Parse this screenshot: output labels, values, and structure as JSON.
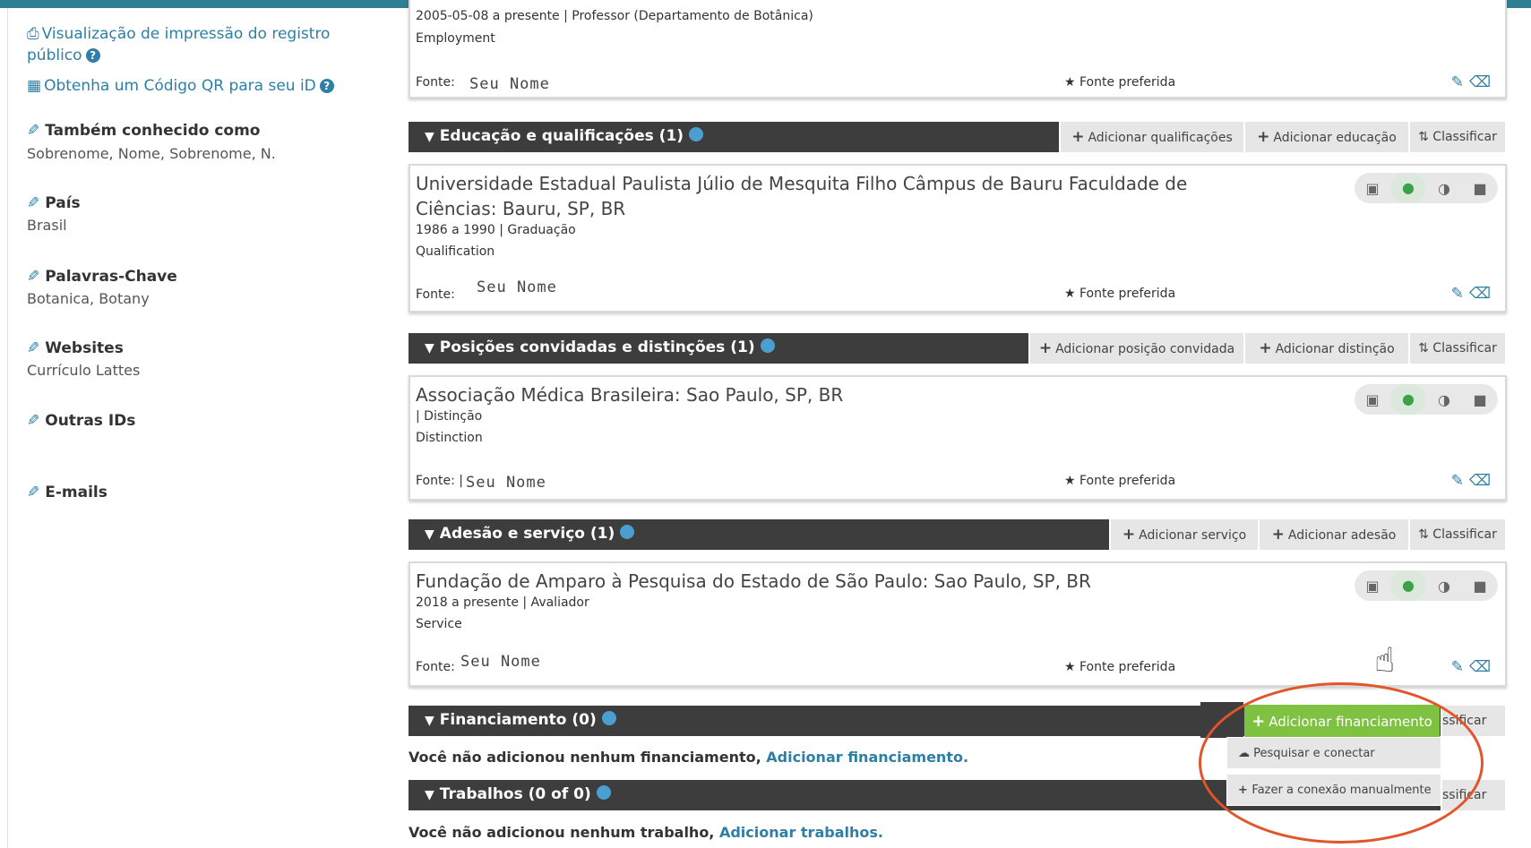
{
  "sidebar": {
    "print_view": "Visualização de impressão do registro público",
    "qr_code": "Obtenha um Código QR para seu iD",
    "aka_title": "Também conhecido como",
    "aka_value": "Sobrenome, Nome, Sobrenome, N.",
    "country_title": "País",
    "country_value": "Brasil",
    "keywords_title": "Palavras-Chave",
    "keywords_value": "Botanica, Botany",
    "websites_title": "Websites",
    "websites_value": "Currículo Lattes",
    "other_ids_title": "Outras IDs",
    "emails_title": "E-mails"
  },
  "employment_card": {
    "meta": "2005-05-08 a presente | Professor (Departamento de Botânica)",
    "type": "Employment",
    "source_label": "Fonte:",
    "source_name": "Seu Nome",
    "preferred": "★ Fonte preferida"
  },
  "education": {
    "header": "Educação e qualificações (1)",
    "btn_add_qualification": "Adicionar qualificações",
    "btn_add_education": "Adicionar educação",
    "btn_sort": "Classificar",
    "card": {
      "title": "Universidade Estadual Paulista Júlio de Mesquita Filho Câmpus de Bauru Faculdade de Ciências: Bauru, SP, BR",
      "meta": "1986 a 1990 | Graduação",
      "type": "Qualification",
      "source_label": "Fonte:",
      "source_name": "Seu Nome",
      "preferred": "★ Fonte preferida"
    }
  },
  "distinctions": {
    "header": "Posições convidadas e distinções (1)",
    "btn_add_invited": "Adicionar posição convidada",
    "btn_add_distinction": "Adicionar distinção",
    "btn_sort": "Classificar",
    "card": {
      "title": "Associação Médica Brasileira: Sao Paulo, SP, BR",
      "meta": "| Distinção",
      "type": "Distinction",
      "source_label": "Fonte: |",
      "source_name": "Seu Nome",
      "preferred": "★ Fonte preferida"
    }
  },
  "membership": {
    "header": "Adesão e serviço (1)",
    "btn_add_service": "Adicionar serviço",
    "btn_add_membership": "Adicionar adesão",
    "btn_sort": "Classificar",
    "card": {
      "title": "Fundação de Amparo à Pesquisa do Estado de São Paulo: Sao Paulo, SP, BR",
      "meta": "2018 a presente | Avaliador",
      "type": "Service",
      "source_label": "Fonte:",
      "source_name": "Seu Nome",
      "preferred": "★ Fonte preferida"
    }
  },
  "funding": {
    "header": "Financiamento (0)",
    "btn_sort_partial": "ssificar",
    "notice_text": "Você não adicionou nenhum financiamento,",
    "notice_link": "Adicionar financiamento.",
    "dropdown": {
      "add_button": "Adicionar financiamento",
      "search_link": "Pesquisar e conectar",
      "manual": "Fazer a conexão manualmente"
    }
  },
  "works": {
    "header": "Trabalhos (0 of 0)",
    "btn_sort_partial": "ssificar",
    "notice_text": "Você não adicionou nenhum trabalho,",
    "notice_link": "Adicionar trabalhos."
  },
  "colors": {
    "header_bg": "#3d3d3d",
    "accent_link": "#2e7fa3",
    "green_button": "#7fc241",
    "highlight_oval": "#e2552b",
    "topbar": "#2e7f91"
  },
  "icons": [
    "print-icon",
    "qr-icon",
    "help-icon",
    "pencil-icon",
    "info-icon",
    "chevron-down-icon",
    "plus-icon",
    "sort-icon",
    "star-icon",
    "trash-icon",
    "visibility-private-icon",
    "visibility-public-icon",
    "visibility-limited-icon",
    "lock-icon",
    "cloud-icon",
    "hand-cursor-icon"
  ]
}
